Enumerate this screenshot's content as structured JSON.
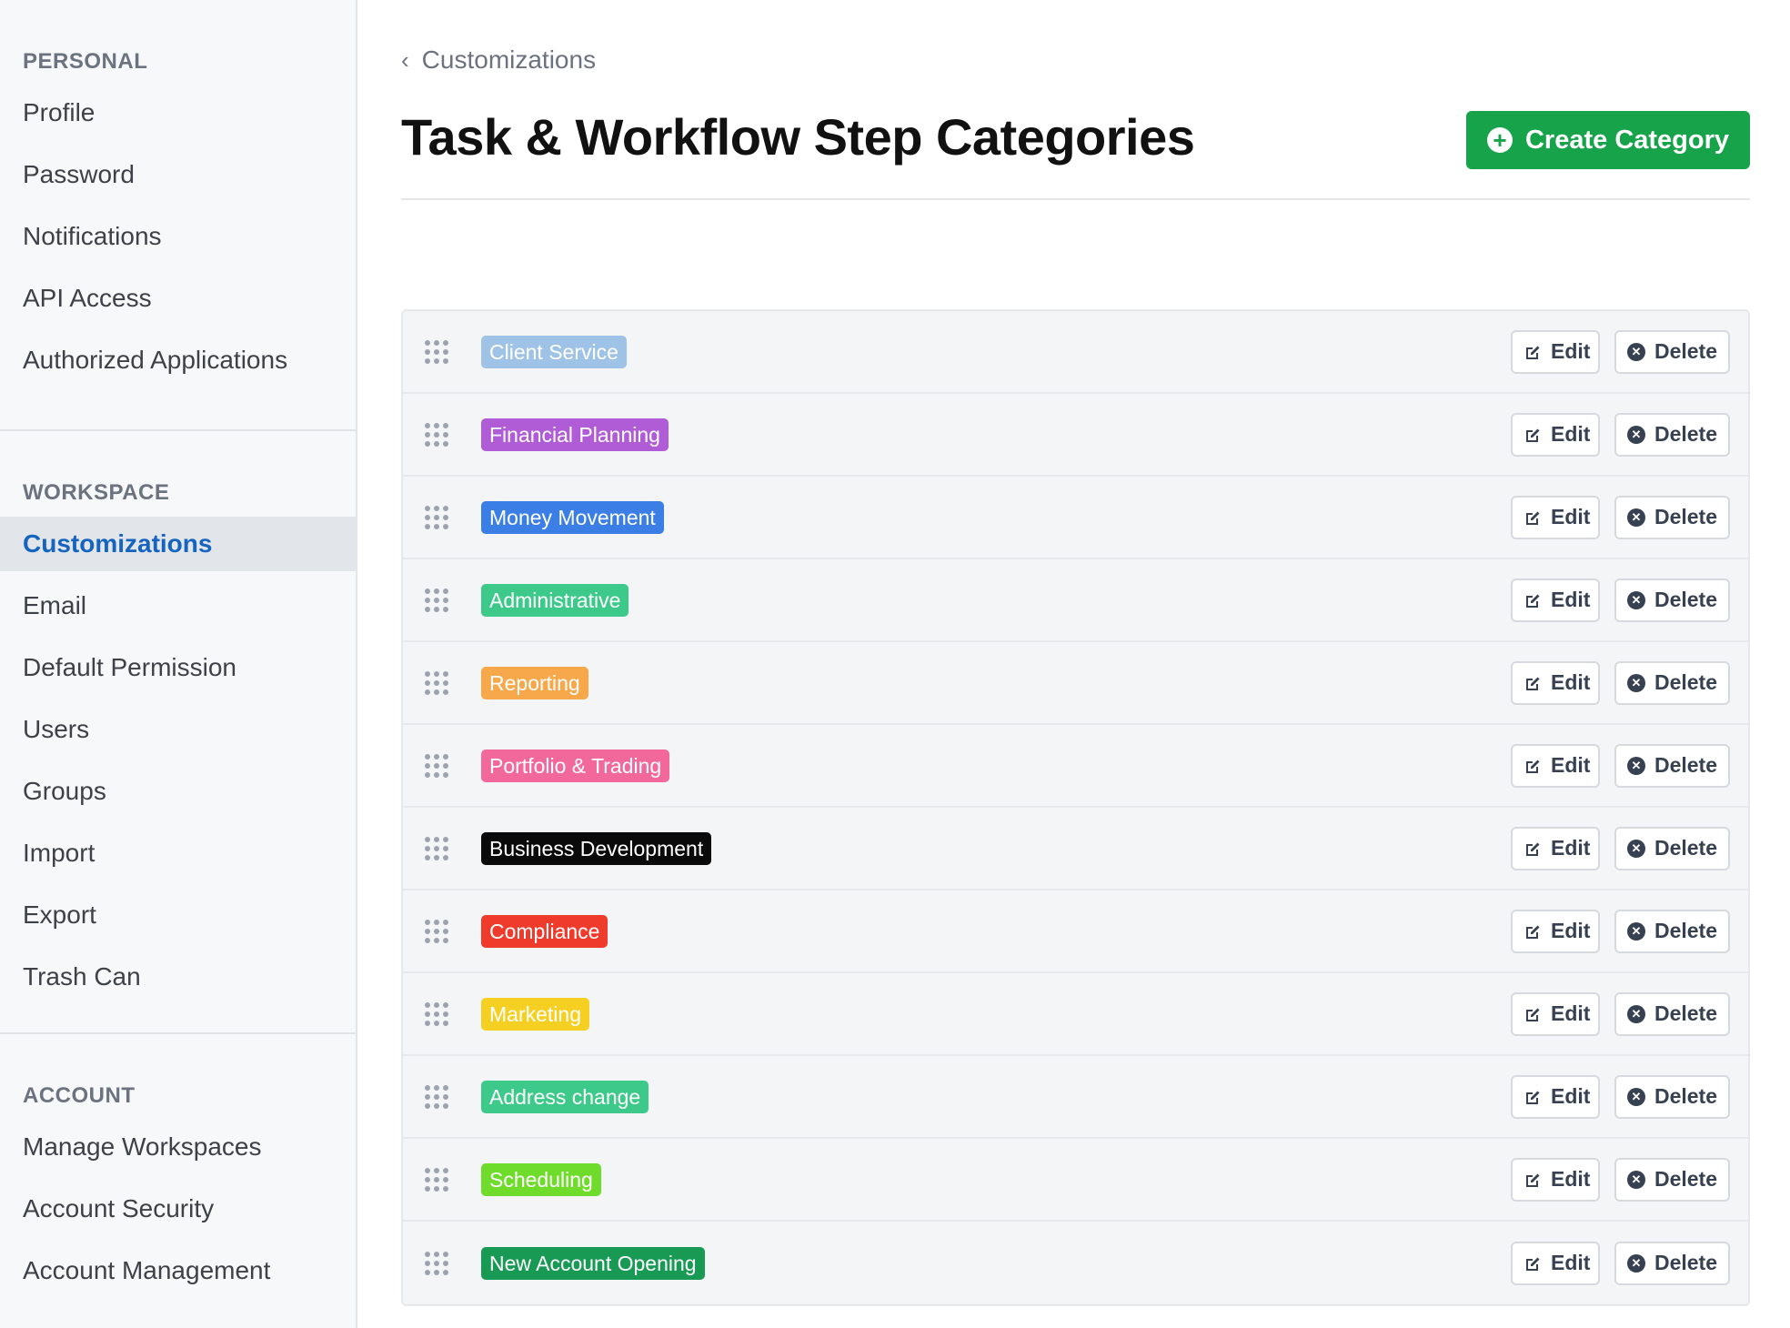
{
  "sidebar": {
    "sections": [
      {
        "heading": "PERSONAL",
        "items": [
          "Profile",
          "Password",
          "Notifications",
          "API Access",
          "Authorized Applications"
        ]
      },
      {
        "heading": "WORKSPACE",
        "items": [
          "Customizations",
          "Email",
          "Default Permission",
          "Users",
          "Groups",
          "Import",
          "Export",
          "Trash Can"
        ],
        "active": "Customizations"
      },
      {
        "heading": "ACCOUNT",
        "items": [
          "Manage Workspaces",
          "Account Security",
          "Account Management"
        ]
      }
    ]
  },
  "header": {
    "breadcrumb": "Customizations",
    "title": "Task & Workflow Step Categories",
    "create_label": "Create Category"
  },
  "actions": {
    "edit_label": "Edit",
    "delete_label": "Delete"
  },
  "categories": [
    {
      "name": "Client Service",
      "color": "#9fc3e6"
    },
    {
      "name": "Financial Planning",
      "color": "#b05cd6"
    },
    {
      "name": "Money Movement",
      "color": "#3a7ee6"
    },
    {
      "name": "Administrative",
      "color": "#3cc98a"
    },
    {
      "name": "Reporting",
      "color": "#f7a84a"
    },
    {
      "name": "Portfolio & Trading",
      "color": "#f2689a"
    },
    {
      "name": "Business Development",
      "color": "#0a0a0a"
    },
    {
      "name": "Compliance",
      "color": "#ef3b2c"
    },
    {
      "name": "Marketing",
      "color": "#f5cf22"
    },
    {
      "name": "Address change",
      "color": "#3cc98a"
    },
    {
      "name": "Scheduling",
      "color": "#6fdc2c"
    },
    {
      "name": "New Account Opening",
      "color": "#189a55"
    }
  ]
}
